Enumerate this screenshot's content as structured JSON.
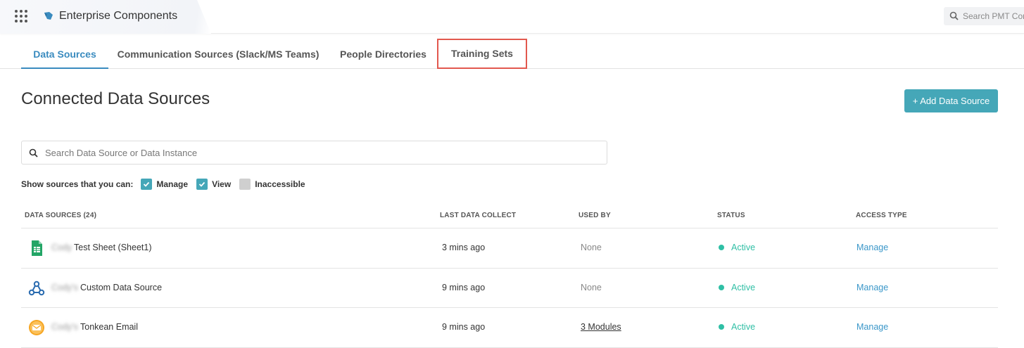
{
  "app": {
    "title": "Enterprise Components"
  },
  "global_search": {
    "placeholder": "Search PMT Com"
  },
  "tabs": [
    {
      "label": "Data Sources",
      "active": true
    },
    {
      "label": "Communication Sources (Slack/MS Teams)"
    },
    {
      "label": "People Directories"
    },
    {
      "label": "Training Sets",
      "highlighted": true
    }
  ],
  "page": {
    "title": "Connected Data Sources",
    "add_button": "+ Add Data Source",
    "search_placeholder": "Search Data Source or Data Instance"
  },
  "filters": {
    "label": "Show sources that you can:",
    "options": [
      {
        "label": "Manage",
        "checked": true
      },
      {
        "label": "View",
        "checked": true
      },
      {
        "label": "Inaccessible",
        "checked": false
      }
    ]
  },
  "table": {
    "headers": [
      "DATA SOURCES (24)",
      "LAST DATA COLLECT",
      "USED BY",
      "STATUS",
      "ACCESS TYPE"
    ],
    "rows": [
      {
        "icon": "google-sheets-icon",
        "owner": "Cody",
        "name": "Test Sheet (Sheet1)",
        "last_collect": "3 mins ago",
        "used_by": "None",
        "status": "Active",
        "access": "Manage"
      },
      {
        "icon": "webhook-icon",
        "owner": "Cody's",
        "name": "Custom Data Source",
        "last_collect": "9 mins ago",
        "used_by": "None",
        "status": "Active",
        "access": "Manage"
      },
      {
        "icon": "email-icon",
        "owner": "Cody's",
        "name": "Tonkean Email",
        "last_collect": "9 mins ago",
        "used_by": "3 Modules",
        "status": "Active",
        "access": "Manage"
      }
    ]
  },
  "colors": {
    "accent": "#45a7b8",
    "tab_active": "#3a8bbf",
    "status_active": "#2fbfa5",
    "highlight_border": "#e2584e",
    "link": "#3a97c9"
  }
}
